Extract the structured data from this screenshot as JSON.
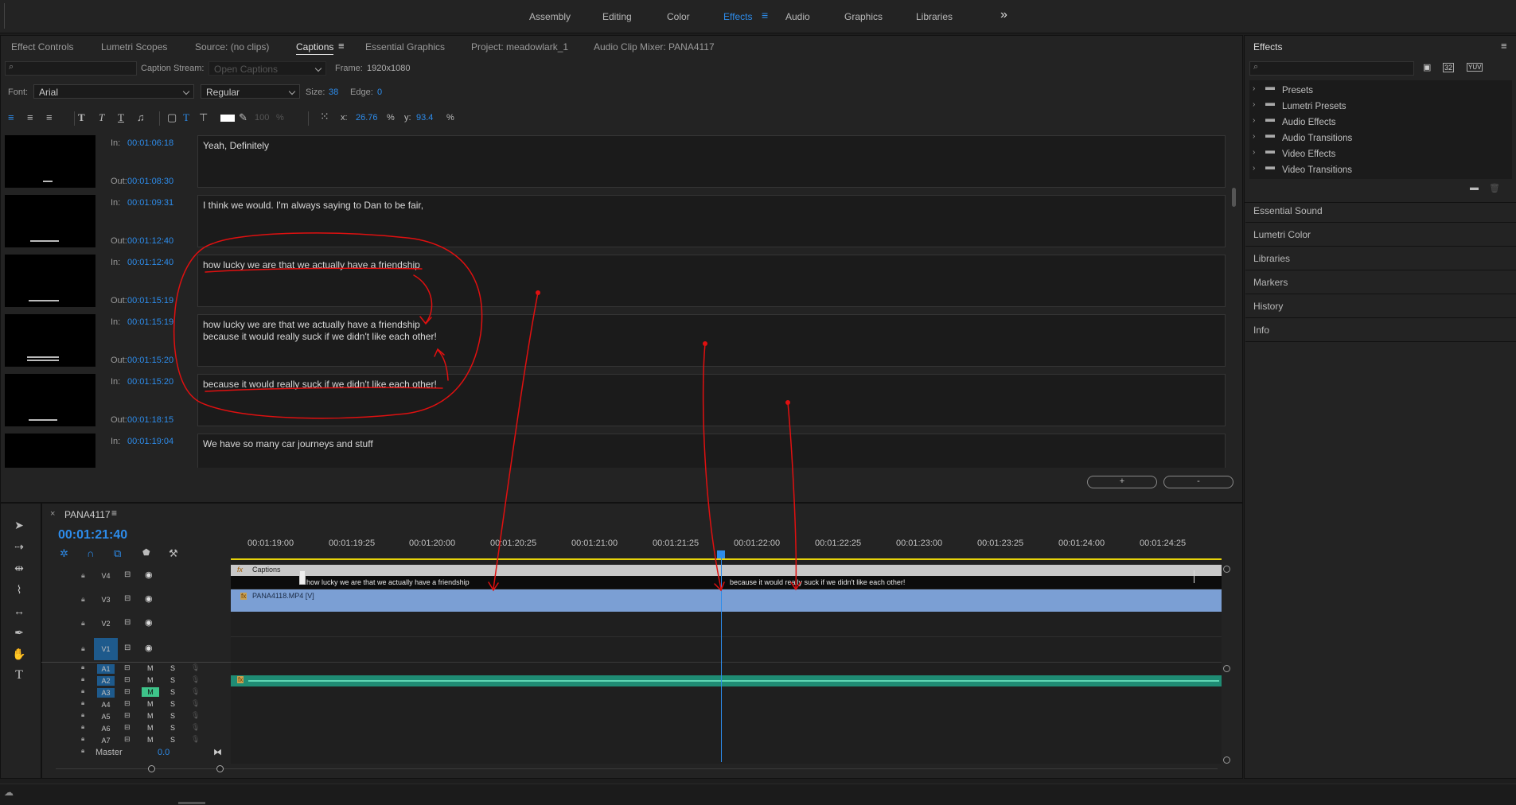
{
  "workspaces": [
    {
      "label": "Assembly",
      "active": false
    },
    {
      "label": "Editing",
      "active": false
    },
    {
      "label": "Color",
      "active": false
    },
    {
      "label": "Effects",
      "active": true
    },
    {
      "label": "Audio",
      "active": false
    },
    {
      "label": "Graphics",
      "active": false
    },
    {
      "label": "Libraries",
      "active": false
    }
  ],
  "top_panel": {
    "tabs": [
      "Effect Controls",
      "Lumetri Scopes",
      "Source: (no clips)",
      "Captions",
      "Essential Graphics",
      "Project: meadowlark_1",
      "Audio Clip Mixer: PANA4117"
    ],
    "active_tab": "Captions",
    "caption_stream_label": "Caption Stream:",
    "caption_stream_value": "Open Captions",
    "frame_label": "Frame:",
    "frame_value": "1920x1080",
    "font_label": "Font:",
    "font_value": "Arial",
    "style_value": "Regular",
    "size_label": "Size:",
    "size_value": "38",
    "edge_label": "Edge:",
    "edge_value": "0",
    "opacity_value": "100",
    "pct": "%",
    "x_label": "x:",
    "x_value": "26.76",
    "y_label": "y:",
    "y_value": "93.4"
  },
  "captions": [
    {
      "in": "00:01:06:18",
      "out": "00:01:08:30",
      "text": "Yeah, Definitely"
    },
    {
      "in": "00:01:09:31",
      "out": "00:01:12:40",
      "text": "I think we would. I'm always saying to Dan to be fair,"
    },
    {
      "in": "00:01:12:40",
      "out": "00:01:15:19",
      "text": "how lucky we are that we actually have a friendship"
    },
    {
      "in": "00:01:15:19",
      "out": "00:01:15:20",
      "text": "how lucky we are that we actually have a friendship\nbecause it would really suck if we didn't like each other!"
    },
    {
      "in": "00:01:15:20",
      "out": "00:01:18:15",
      "text": "because it would really suck if we didn't like each other!"
    },
    {
      "in": "00:01:19:04",
      "out": "",
      "text": "We have so many car journeys and stuff"
    }
  ],
  "in_label": "In:",
  "out_label": "Out:",
  "add_button": "+",
  "remove_button": "-",
  "timeline": {
    "sequence_name": "PANA4117",
    "timecode": "00:01:21:40",
    "ruler": [
      "00:01:19:00",
      "00:01:19:25",
      "00:01:20:00",
      "00:01:20:25",
      "00:01:21:00",
      "00:01:21:25",
      "00:01:22:00",
      "00:01:22:25",
      "00:01:23:00",
      "00:01:23:25",
      "00:01:24:00",
      "00:01:24:25"
    ],
    "video_tracks": [
      "V4",
      "V3",
      "V2",
      "V1"
    ],
    "audio_tracks": [
      "A1",
      "A2",
      "A3",
      "A4",
      "A5",
      "A6",
      "A7"
    ],
    "mute_label": "M",
    "solo_label": "S",
    "master_label": "Master",
    "master_value": "0.0",
    "captions_track_label": "Captions",
    "caption_clip_1": "how lucky we are that we actually have a friendship",
    "caption_clip_2": "because it would really suck if we didn't like each other!",
    "video_clip": "PANA4118.MP4 [V]",
    "fx_label": "fx"
  },
  "effects_panel": {
    "title": "Effects",
    "items": [
      "Presets",
      "Lumetri Presets",
      "Audio Effects",
      "Audio Transitions",
      "Video Effects",
      "Video Transitions"
    ],
    "badges": [
      "32",
      "YUV"
    ]
  },
  "side_panels": [
    "Essential Sound",
    "Lumetri Color",
    "Libraries",
    "Markers",
    "History",
    "Info"
  ],
  "colors": {
    "accent": "#2d8ceb",
    "annotation": "#e01010",
    "caption_track": "#c8c8c8",
    "video_clip": "#7b9fd4",
    "audio_clip": "#1f8c74"
  }
}
